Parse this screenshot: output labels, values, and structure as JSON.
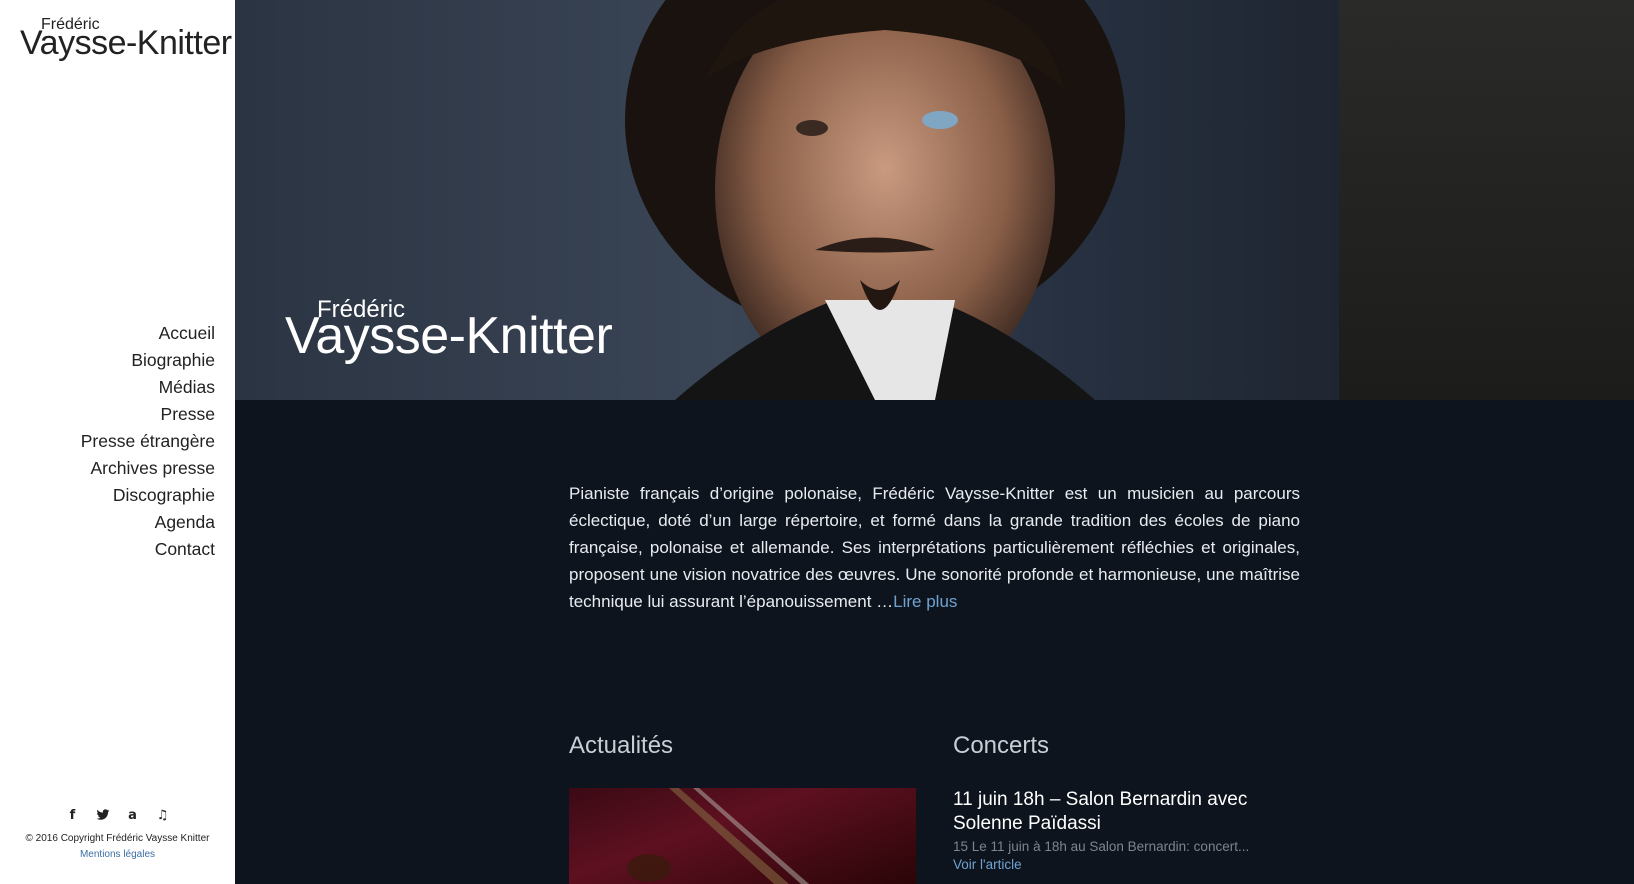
{
  "sidebar": {
    "logo": {
      "first": "Frédéric",
      "last": "Vaysse-Knitter"
    },
    "nav": [
      "Accueil",
      "Biographie",
      "Médias",
      "Presse",
      "Presse étrangère",
      "Archives presse",
      "Discographie",
      "Agenda",
      "Contact"
    ],
    "social_icons": [
      "facebook-icon",
      "twitter-icon",
      "amazon-icon",
      "music-icon"
    ],
    "copyright": "© 2016 Copyright Frédéric Vaysse Knitter",
    "legal": "Mentions légales"
  },
  "hero": {
    "first": "Frédéric",
    "last": "Vaysse-Knitter"
  },
  "intro": {
    "text": "Pianiste français d’origine polonaise, Frédéric Vaysse-Knitter est un musicien au parcours éclectique, doté d’un large répertoire, et formé dans la grande tradition des écoles de piano française, polonaise et allemande. Ses interprétations particulièrement réfléchies et originales, proposent une vision novatrice des œuvres. Une sonorité profonde et harmonieuse, une maîtrise technique lui assurant l’épanouissement …",
    "read_more": "Lire plus"
  },
  "sections": {
    "news": "Actualités",
    "concerts": "Concerts"
  },
  "concert": {
    "title": "11 juin 18h – Salon Bernardin avec Solenne Païdassi",
    "excerpt": "15 Le 11 juin à 18h au Salon Bernardin: concert...",
    "link": "Voir l'article"
  },
  "colors": {
    "background": "#0d141d",
    "link": "#6fa2d1",
    "sidebar": "#ffffff"
  }
}
